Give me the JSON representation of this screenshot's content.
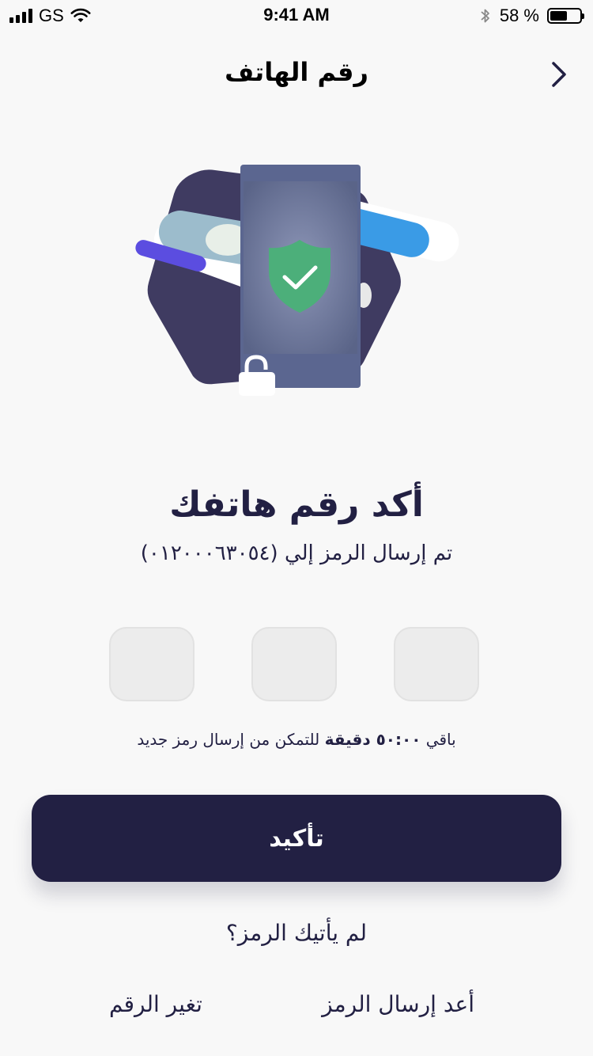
{
  "status_bar": {
    "carrier": "GS",
    "time": "9:41 AM",
    "battery_percent": "58 %",
    "battery_level": 0.58,
    "icons": [
      "signal-icon",
      "wifi-icon",
      "bluetooth-icon",
      "battery-icon"
    ]
  },
  "nav": {
    "title": "رقم الهاتف",
    "back_icon": "chevron-right-icon"
  },
  "illustration": {
    "icons": [
      "shield-check-icon",
      "padlock-open-icon",
      "phone-illustration"
    ],
    "colors": {
      "hexagon": "#3f3b61",
      "shield": "#4caf7a",
      "phone": "#5b6690",
      "stripe_blue": "#3a9be6",
      "stripe_purple": "#5b4de0"
    }
  },
  "main": {
    "headline": "أكد رقم هاتفك",
    "subline": "تم إرسال الرمز إلي (٠١٢٠٠٠٦٣٠٥٤)",
    "code_boxes": [
      "",
      "",
      ""
    ],
    "timer_prefix": "باقي ",
    "timer_value": "٥٠:٠٠ دقيقة",
    "timer_suffix": " للتمكن من إرسال رمز جديد",
    "confirm_label": "تأكيد",
    "no_code": "لم يأتيك الرمز؟",
    "resend_label": "أعد إرسال الرمز",
    "change_label": "تغير الرقم"
  },
  "colors": {
    "primary": "#222043",
    "background": "#f8f8f8",
    "input_bg": "#ececec"
  }
}
